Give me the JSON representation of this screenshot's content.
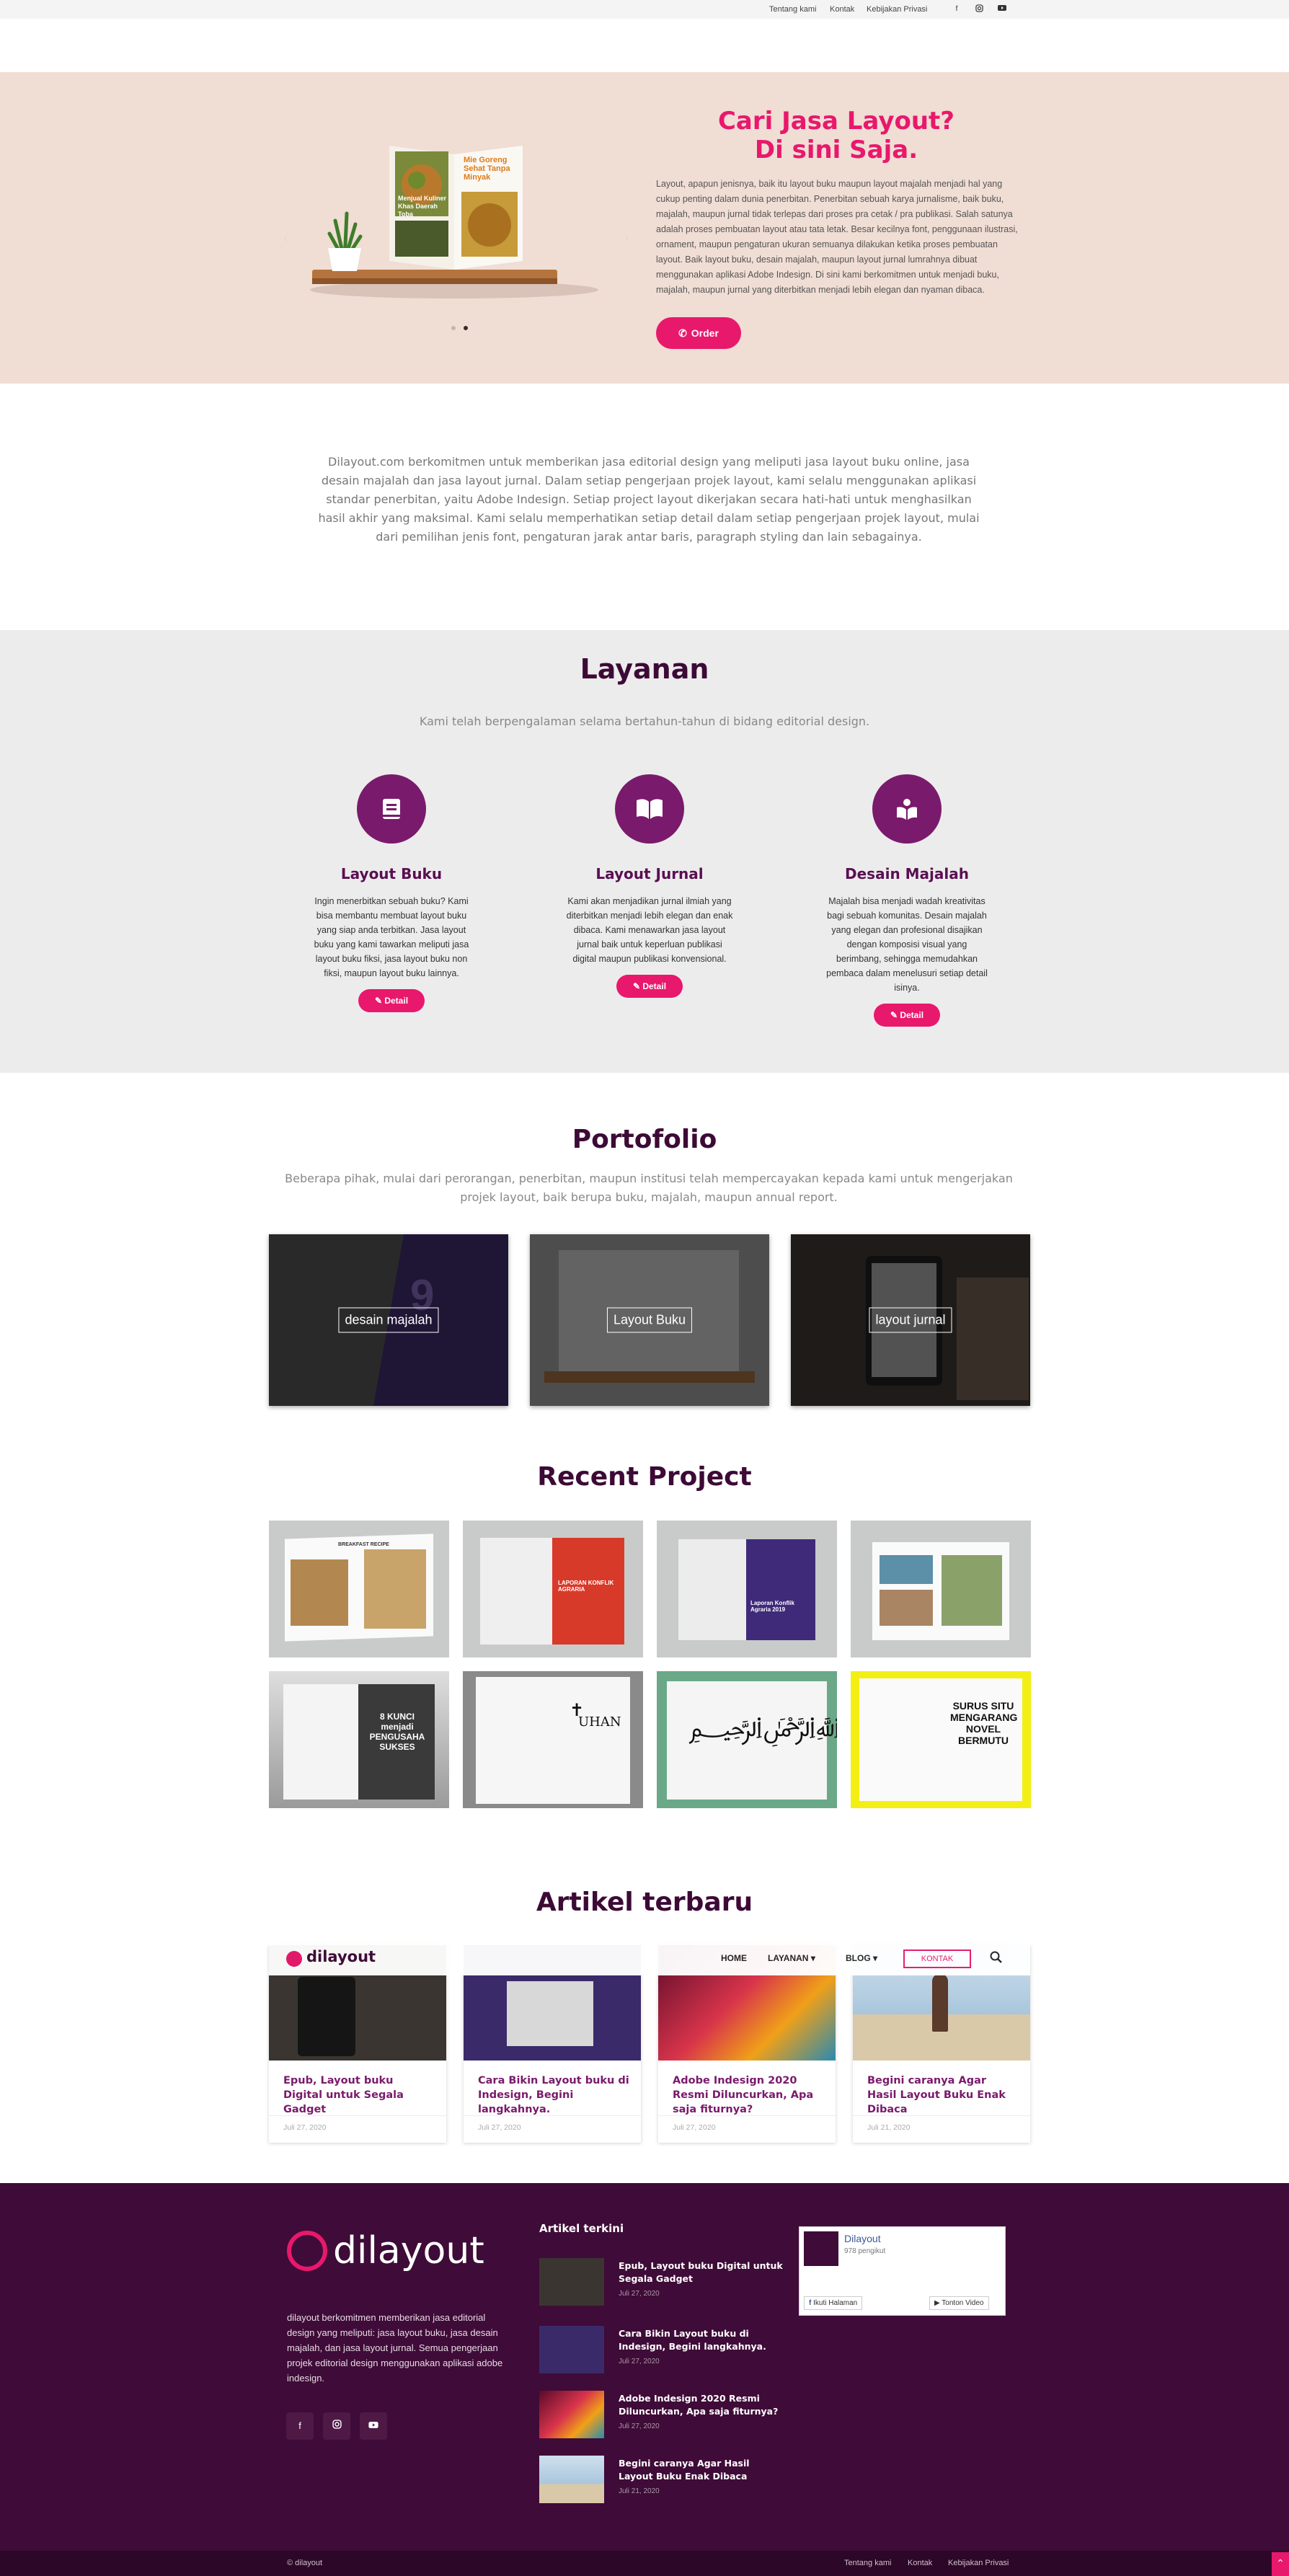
{
  "topbar": {
    "links": [
      "Tentang kami",
      "Kontak",
      "Kebijakan Privasi"
    ],
    "social": [
      "facebook-icon",
      "instagram-icon",
      "youtube-icon"
    ]
  },
  "hero": {
    "title_line1": "Cari Jasa Layout?",
    "title_line2": "Di sini Saja.",
    "text": "Layout, apapun jenisnya, baik itu layout buku maupun layout majalah menjadi hal yang cukup penting dalam dunia penerbitan. Penerbitan sebuah karya jurnalisme, baik buku, majalah, maupun jurnal tidak terlepas dari proses pra cetak / pra publikasi. Salah satunya adalah proses pembuatan layout atau tata letak. Besar kecilnya font, penggunaan ilustrasi, ornament, maupun pengaturan ukuran semuanya dilakukan ketika proses pembuatan layout. Baik layout buku, desain majalah, maupun layout jurnal lumrahnya dibuat menggunakan aplikasi Adobe Indesign. Di sini kami berkomitmen untuk menjadi buku, majalah, maupun jurnal yang diterbitkan menjadi lebih elegan dan nyaman dibaca.",
    "order_label": "Order",
    "slide_book_title1": "Menjual Kuliner",
    "slide_book_title2": "Khas Daerah Toba",
    "slide_book_right": "Mie Goreng Sehat Tanpa Minyak"
  },
  "intro": "Dilayout.com berkomitmen untuk memberikan jasa editorial design yang meliputi jasa layout buku online, jasa desain majalah dan jasa layout jurnal. Dalam setiap pengerjaan projek layout, kami selalu menggunakan aplikasi standar penerbitan,  yaitu Adobe Indesign.  Setiap project layout dikerjakan secara hati-hati untuk menghasilkan hasil akhir yang maksimal. Kami selalu memperhatikan setiap detail dalam setiap pengerjaan projek layout, mulai dari pemilihan jenis font, pengaturan jarak antar baris, paragraph styling dan lain sebagainya.",
  "layanan": {
    "title": "Layanan",
    "subtitle": "Kami telah berpengalaman selama bertahun-tahun di bidang editorial design.",
    "services": [
      {
        "name": "Layout Buku",
        "desc": "Ingin menerbitkan sebuah buku? Kami bisa membantu membuat layout buku yang siap anda terbitkan. Jasa layout buku yang kami tawarkan meliputi jasa layout buku fiksi, jasa layout buku non fiksi, maupun layout buku lainnya.",
        "button": "Detail",
        "icon": "book-icon"
      },
      {
        "name": "Layout Jurnal",
        "desc": "Kami akan menjadikan jurnal ilmiah yang diterbitkan menjadi lebih elegan dan enak dibaca. Kami menawarkan jasa layout jurnal baik untuk keperluan publikasi digital maupun publikasi konvensional.",
        "button": "Detail",
        "icon": "open-book-icon"
      },
      {
        "name": "Desain Majalah",
        "desc": "Majalah bisa menjadi wadah kreativitas bagi sebuah komunitas. Desain majalah yang elegan dan profesional disajikan dengan komposisi visual yang berimbang, sehingga memudahkan pembaca dalam menelusuri setiap detail isinya.",
        "button": "Detail",
        "icon": "reader-icon"
      }
    ]
  },
  "portfolio": {
    "title": "Portofolio",
    "subtitle": "Beberapa pihak, mulai dari perorangan, penerbitan, maupun institusi telah mempercayakan kepada kami untuk mengerjakan projek layout, baik berupa buku, majalah, maupun annual report.",
    "items": [
      "desain majalah",
      "Layout Buku",
      "layout jurnal"
    ]
  },
  "recent": {
    "title": "Recent Project",
    "items": [
      {
        "text": "BREAKFAST RECIPE"
      },
      {
        "text": "LAPORAN KONFLIK AGRARIA"
      },
      {
        "text": "Laporan Konflik Agraria 2019"
      },
      {
        "text": ""
      },
      {
        "text": "8 KUNCI menjadi PENGUSAHA SUKSES"
      },
      {
        "text": "UHAN"
      },
      {
        "text": ""
      },
      {
        "text": "SURUS SITU MENGARANG NOVEL BERMUTU"
      }
    ]
  },
  "articles": {
    "title": "Artikel terbaru",
    "items": [
      {
        "title": "Epub, Layout buku Digital untuk Segala Gadget",
        "date": "Juli 27, 2020"
      },
      {
        "title": "Cara Bikin Layout buku di Indesign, Begini langkahnya.",
        "date": "Juli 27, 2020"
      },
      {
        "title": "Adobe Indesign 2020 Resmi Diluncurkan, Apa saja fiturnya?",
        "date": "Juli 27, 2020"
      },
      {
        "title": "Begini caranya Agar Hasil Layout Buku Enak Dibaca",
        "date": "Juli 21, 2020"
      }
    ]
  },
  "nav": {
    "logo": "dilayout",
    "items": [
      "HOME",
      "LAYANAN",
      "BLOG"
    ],
    "kontak": "KONTAK"
  },
  "footer": {
    "logo": "dilayout",
    "about": "dilayout berkomitmen memberikan jasa editorial design yang meliputi: jasa layout buku, jasa desain majalah, dan jasa layout jurnal. Semua pengerjaan projek editorial design menggunakan aplikasi adobe indesign.",
    "recent_title": "Artikel terkini",
    "recent": [
      {
        "title": "Epub, Layout buku Digital untuk Segala Gadget",
        "date": "Juli 27, 2020"
      },
      {
        "title": "Cara Bikin Layout buku di Indesign, Begini langkahnya.",
        "date": "Juli 27, 2020"
      },
      {
        "title": "Adobe Indesign 2020 Resmi Diluncurkan, Apa saja fiturnya?",
        "date": "Juli 27, 2020"
      },
      {
        "title": "Begini caranya Agar Hasil Layout Buku Enak Dibaca",
        "date": "Juli 21, 2020"
      }
    ],
    "fb": {
      "name": "Dilayout",
      "followers": "978 pengikut",
      "follow": "Ikuti Halaman",
      "watch": "Tonton Video"
    },
    "copyright": "© dilayout",
    "links": [
      "Tentang kami",
      "Kontak",
      "Kebijakan Privasi"
    ]
  },
  "colors": {
    "accent": "#e8186c",
    "brand": "#3f0b38",
    "hero_bg": "#f0ddd4",
    "section_bg": "#ececec"
  }
}
